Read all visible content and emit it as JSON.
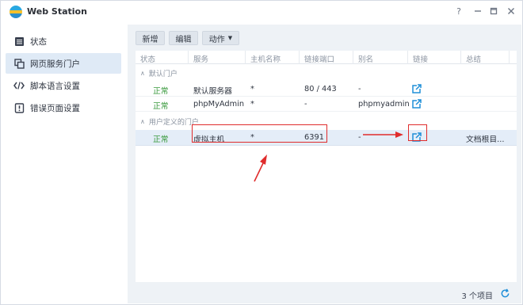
{
  "window": {
    "title": "Web Station",
    "buttons": {
      "help": "?",
      "minimize": "–",
      "maximize": "□",
      "close": "✕"
    }
  },
  "sidebar": {
    "items": [
      {
        "label": "状态",
        "icon": "status-icon"
      },
      {
        "label": "网页服务门户",
        "icon": "portal-icon",
        "active": true
      },
      {
        "label": "脚本语言设置",
        "icon": "code-icon"
      },
      {
        "label": "错误页面设置",
        "icon": "error-icon"
      }
    ]
  },
  "toolbar": {
    "add": "新增",
    "edit": "编辑",
    "action": "动作"
  },
  "table": {
    "headers": [
      "状态",
      "服务",
      "主机名称",
      "链接端口",
      "别名",
      "链接",
      "总结"
    ],
    "groups": [
      {
        "label": "默认门户",
        "rows": [
          {
            "status": "正常",
            "service": "默认服务器",
            "host": "*",
            "port": "80 / 443",
            "alias": "-",
            "summary": ""
          },
          {
            "status": "正常",
            "service": "phpMyAdmin",
            "host": "*",
            "port": "-",
            "alias": "phpmyadmin",
            "summary": ""
          }
        ]
      },
      {
        "label": "用户定义的门户",
        "rows": [
          {
            "status": "正常",
            "service": "虚拟主机",
            "host": "*",
            "port": "6391",
            "alias": "-",
            "summary": "文档根目..."
          }
        ]
      }
    ]
  },
  "footer": {
    "count": "3 个项目"
  },
  "colors": {
    "accent": "#1f8fd8",
    "status_ok": "#3a9a3e",
    "annotation": "#e02c2c"
  }
}
